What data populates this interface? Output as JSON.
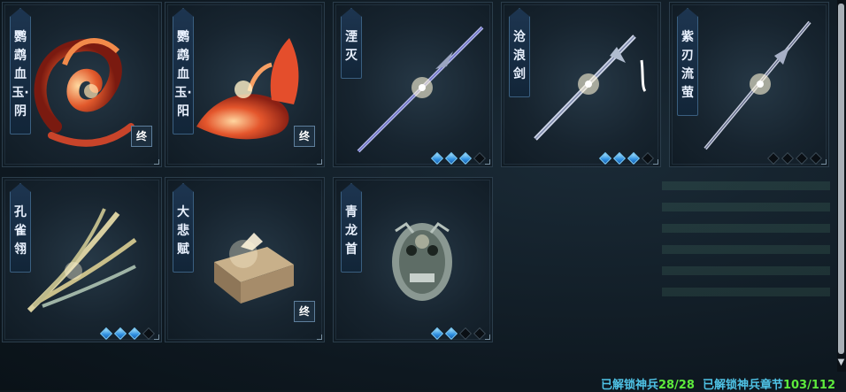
{
  "cards": [
    {
      "id": "c1",
      "name": "鹦鹉血玉·阴",
      "rank": "终",
      "diamonds": null
    },
    {
      "id": "c2",
      "name": "鹦鹉血玉·阳",
      "rank": "终",
      "diamonds": null
    },
    {
      "id": "c3",
      "name": "湮灭",
      "rank": null,
      "diamonds": [
        1,
        1,
        1,
        0
      ]
    },
    {
      "id": "c4",
      "name": "沧浪剑",
      "rank": null,
      "diamonds": [
        1,
        1,
        1,
        0
      ]
    },
    {
      "id": "c5",
      "name": "紫刃流萤",
      "rank": null,
      "diamonds": [
        0,
        0,
        0,
        0
      ]
    },
    {
      "id": "c6",
      "name": "孔雀翎",
      "rank": null,
      "diamonds": [
        1,
        1,
        1,
        0
      ]
    },
    {
      "id": "c7",
      "name": "大悲赋",
      "rank": "终",
      "diamonds": null
    },
    {
      "id": "c8",
      "name": "青龙首",
      "rank": null,
      "diamonds": [
        1,
        1,
        0,
        0
      ]
    }
  ],
  "status": {
    "weapons_label": "已解锁神兵",
    "weapons_value": "28/28",
    "chapters_label": "已解锁神兵章节",
    "chapters_value": "103/112"
  },
  "colors": {
    "status_label": "#4fc3e6",
    "status_value": "#5dea3c",
    "diamond_on": "#2f8fe0"
  },
  "scrollbar": {
    "down_arrow_icon": "chevron-down-icon"
  }
}
